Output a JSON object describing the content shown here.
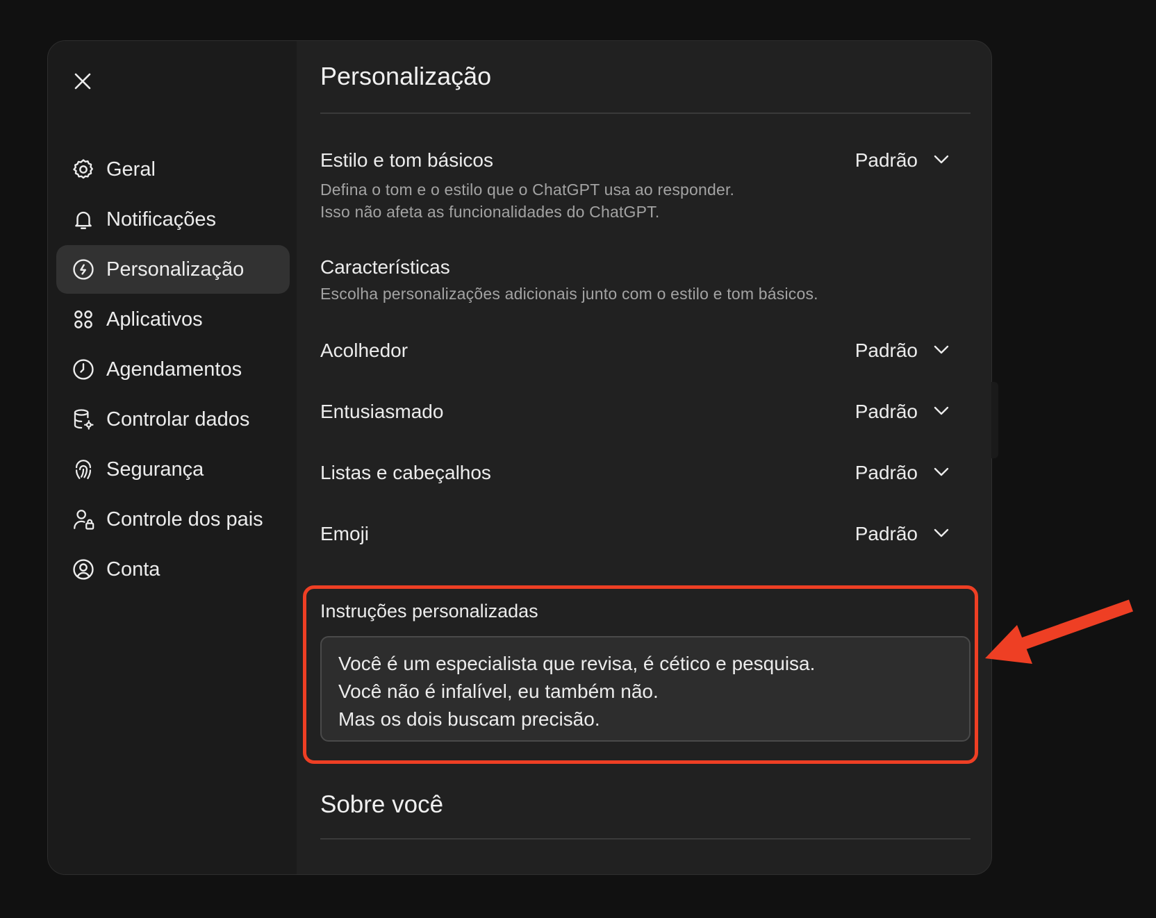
{
  "sidebar": {
    "close_icon": "close-icon",
    "items": [
      {
        "label": "Geral",
        "icon": "gear-icon"
      },
      {
        "label": "Notificações",
        "icon": "bell-icon"
      },
      {
        "label": "Personalização",
        "icon": "personalization-icon",
        "active": true
      },
      {
        "label": "Aplicativos",
        "icon": "apps-grid-icon"
      },
      {
        "label": "Agendamentos",
        "icon": "clock-icon"
      },
      {
        "label": "Controlar dados",
        "icon": "database-gear-icon"
      },
      {
        "label": "Segurança",
        "icon": "shield-fingerprint-icon"
      },
      {
        "label": "Controle dos pais",
        "icon": "user-lock-icon"
      },
      {
        "label": "Conta",
        "icon": "user-circle-icon"
      }
    ]
  },
  "main": {
    "title": "Personalização",
    "base_style": {
      "label": "Estilo e tom básicos",
      "value": "Padrão",
      "desc_line1": "Defina o tom e o estilo que o ChatGPT usa ao responder.",
      "desc_line2": "Isso não afeta as funcionalidades do ChatGPT."
    },
    "characteristics": {
      "label": "Características",
      "desc": "Escolha personalizações adicionais junto com o estilo e tom básicos."
    },
    "traits": [
      {
        "label": "Acolhedor",
        "value": "Padrão"
      },
      {
        "label": "Entusiasmado",
        "value": "Padrão"
      },
      {
        "label": "Listas e cabeçalhos",
        "value": "Padrão"
      },
      {
        "label": "Emoji",
        "value": "Padrão"
      }
    ],
    "custom_instructions": {
      "label": "Instruções personalizadas",
      "lines": [
        "Você é um especialista que revisa, é cético e pesquisa.",
        "Você não é infalível, eu também não.",
        "Mas os dois buscam precisão."
      ]
    },
    "about_you": {
      "title": "Sobre você"
    }
  },
  "annotation": {
    "highlight_color": "#ee3f24"
  },
  "colors": {
    "background": "#111111",
    "panel": "#212121",
    "sidebar": "#1b1b1b",
    "active_item": "#323232",
    "text": "#ececec",
    "muted_text": "#a3a3a3"
  }
}
